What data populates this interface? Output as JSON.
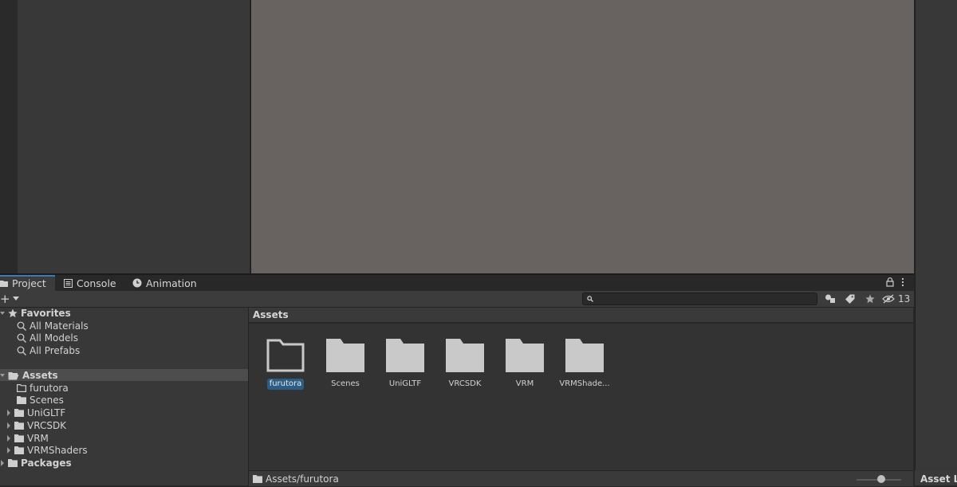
{
  "tabs": [
    {
      "label": "Project",
      "icon": "folder-icon",
      "active": true
    },
    {
      "label": "Console",
      "icon": "console-icon"
    },
    {
      "label": "Animation",
      "icon": "clock-icon"
    }
  ],
  "toolbar": {
    "add_label": "+",
    "search_value": "",
    "hidden_count": "13"
  },
  "tree": {
    "favorites": {
      "label": "Favorites",
      "items": [
        "All Materials",
        "All Models",
        "All Prefabs"
      ]
    },
    "assets": {
      "label": "Assets",
      "items": [
        "furutora",
        "Scenes",
        "UniGLTF",
        "VRCSDK",
        "VRM",
        "VRMShaders"
      ]
    },
    "packages": {
      "label": "Packages"
    }
  },
  "grid": {
    "breadcrumb": "Assets",
    "folders": [
      {
        "label": "furutora",
        "selected": true,
        "empty": true
      },
      {
        "label": "Scenes"
      },
      {
        "label": "UniGLTF"
      },
      {
        "label": "VRCSDK"
      },
      {
        "label": "VRM"
      },
      {
        "label": "VRMShade..."
      }
    ]
  },
  "status": {
    "path": "Assets/furutora"
  },
  "right_panel": {
    "title": "Asset La"
  },
  "colors": {
    "accent": "#3a79bb",
    "selection": "#2c5d87",
    "scene_bg": "#686360"
  }
}
